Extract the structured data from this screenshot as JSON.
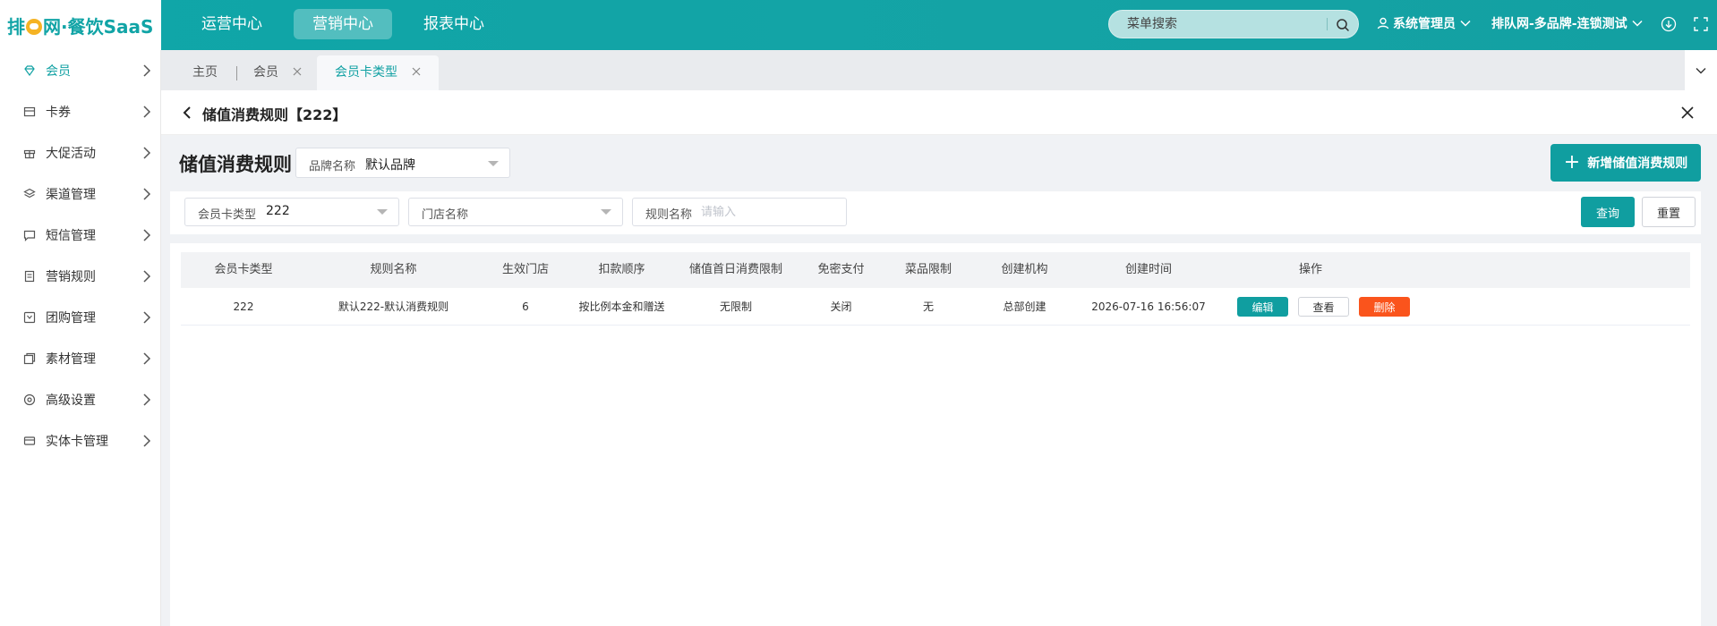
{
  "app": {
    "logo_text_left": "排",
    "logo_text_mid": "网·餐饮SaaS"
  },
  "topnav": {
    "items": [
      {
        "label": "运营中心"
      },
      {
        "label": "营销中心"
      },
      {
        "label": "报表中心"
      }
    ],
    "active_index": 1
  },
  "search": {
    "placeholder": "菜单搜索"
  },
  "user": {
    "name": "系统管理员"
  },
  "org": {
    "name": "排队网-多品牌-连锁测试"
  },
  "sidebar": {
    "items": [
      {
        "label": "会员",
        "icon": "gem-icon"
      },
      {
        "label": "卡券",
        "icon": "coupon-icon"
      },
      {
        "label": "大促活动",
        "icon": "gift-icon"
      },
      {
        "label": "渠道管理",
        "icon": "layers-icon"
      },
      {
        "label": "短信管理",
        "icon": "message-icon"
      },
      {
        "label": "营销规则",
        "icon": "document-icon"
      },
      {
        "label": "团购管理",
        "icon": "group-buy-icon"
      },
      {
        "label": "素材管理",
        "icon": "material-icon"
      },
      {
        "label": "高级设置",
        "icon": "settings-icon"
      },
      {
        "label": "实体卡管理",
        "icon": "card-icon"
      }
    ],
    "active_index": 0
  },
  "tabs": {
    "home": "主页",
    "items": [
      {
        "label": "会员"
      },
      {
        "label": "会员卡类型"
      }
    ]
  },
  "page": {
    "title": "储值消费规则【222】",
    "section_title": "储值消费规则",
    "brand_label": "品牌名称",
    "brand_value": "默认品牌",
    "add_button": "新增储值消费规则"
  },
  "filters": {
    "card_type_label": "会员卡类型",
    "card_type_value": "222",
    "store_label": "门店名称",
    "rule_label": "规则名称",
    "rule_placeholder": "请输入",
    "query_button": "查询",
    "reset_button": "重置"
  },
  "table": {
    "columns": [
      "会员卡类型",
      "规则名称",
      "生效门店",
      "扣款顺序",
      "储值首日消费限制",
      "免密支付",
      "菜品限制",
      "创建机构",
      "创建时间",
      "操作"
    ],
    "rows": [
      {
        "card_type": "222",
        "rule_name": "默认222-默认消费规则",
        "stores": "6",
        "order": "按比例本金和赠送",
        "first_day_limit": "无限制",
        "password_free": "关闭",
        "dish_limit": "无",
        "creator": "总部创建",
        "created_at": "2026-07-16 16:56:07",
        "actions": {
          "edit": "编辑",
          "view": "查看",
          "delete": "删除"
        }
      }
    ]
  },
  "colors": {
    "primary": "#109ea0",
    "danger": "#fa541c"
  }
}
